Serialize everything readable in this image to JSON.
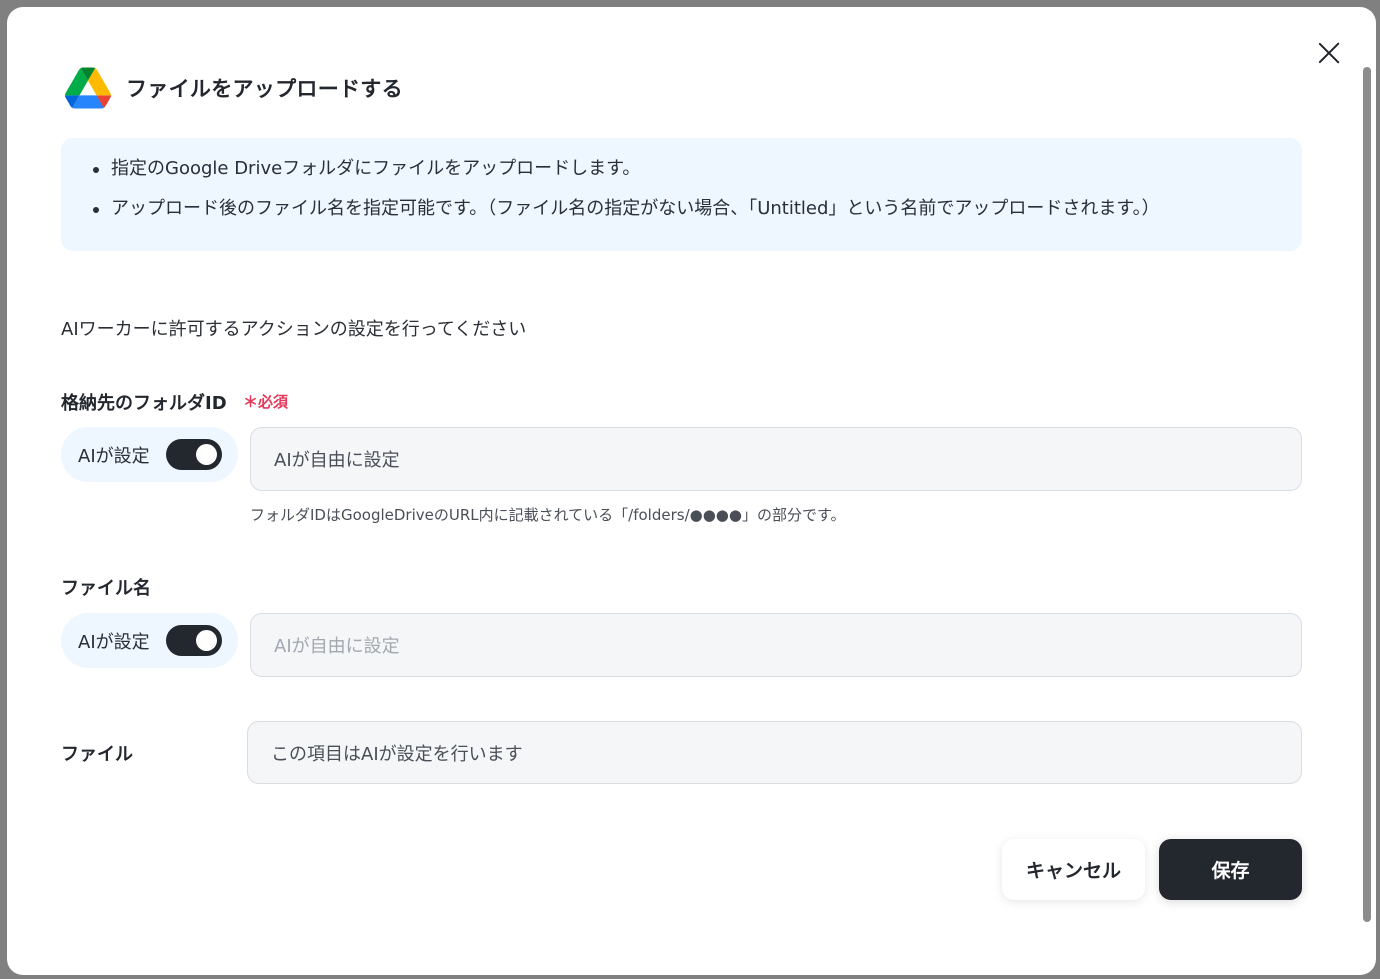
{
  "modal": {
    "title": "ファイルをアップロードする",
    "icon": "google-drive-icon"
  },
  "info": {
    "items": [
      "指定のGoogle Driveフォルダにファイルをアップロードします。",
      "アップロード後のファイル名を指定可能です。（ファイル名の指定がない場合、「Untitled」という名前でアップロードされます。）"
    ]
  },
  "instruction": "AIワーカーに許可するアクションの設定を行ってください",
  "fields": {
    "folder_id": {
      "label": "格納先のフォルダID",
      "required": "＊必須",
      "toggle_label": "AIが設定",
      "toggle_on": true,
      "value": "AIが自由に設定",
      "helper": "フォルダIDはGoogleDriveのURL内に記載されている「/folders/●●●●」の部分です。"
    },
    "file_name": {
      "label": "ファイル名",
      "toggle_label": "AIが設定",
      "toggle_on": true,
      "placeholder": "AIが自由に設定"
    },
    "file": {
      "label": "ファイル",
      "value": "この項目はAIが設定を行います"
    }
  },
  "actions": {
    "cancel": "キャンセル",
    "save": "保存"
  },
  "colors": {
    "primary_dark": "#23272e",
    "info_bg": "#eef6ff",
    "required_red": "#e5395a"
  }
}
